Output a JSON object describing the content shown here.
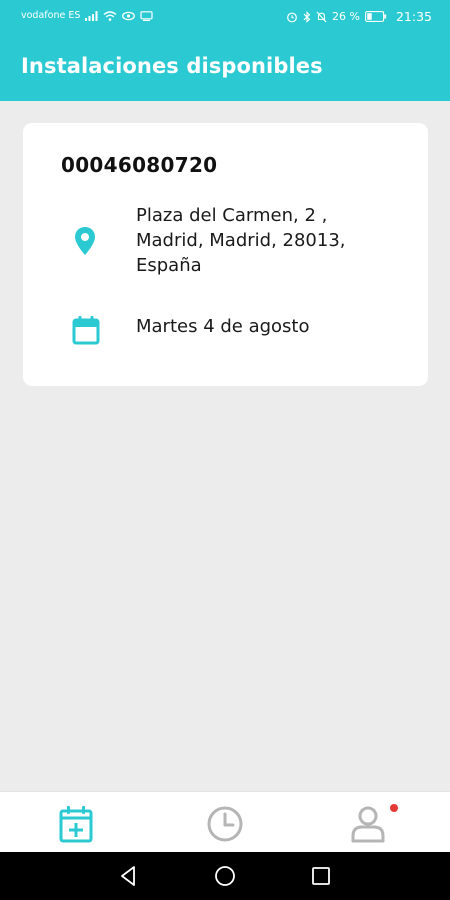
{
  "status_bar": {
    "carrier": "vodafone ES",
    "battery_percent": "26 %",
    "time": "21:35",
    "icons": [
      "signal-icon",
      "wifi-icon",
      "eye-icon",
      "screen-icon",
      "alarm-icon",
      "bluetooth-icon",
      "mute-icon",
      "battery-icon"
    ]
  },
  "header": {
    "title": "Instalaciones disponibles",
    "background_color": "#2bcad3"
  },
  "card": {
    "id_number": "00046080720",
    "address": "Plaza del Carmen, 2 ,\nMadrid, Madrid, 28013,\nEspaña",
    "date": "Martes 4 de agosto",
    "icons": {
      "address": "location-pin-icon",
      "date": "calendar-icon"
    },
    "icon_color": "#2bcad3"
  },
  "bottom_nav": {
    "items": [
      {
        "icon": "calendar-add-icon",
        "active": true
      },
      {
        "icon": "clock-icon",
        "active": false
      },
      {
        "icon": "user-icon",
        "active": false,
        "notification": true
      }
    ],
    "active_color": "#2bcad3",
    "inactive_color": "#b5b5b5",
    "notification_color": "#e53935"
  },
  "system_nav": {
    "icons": [
      "back-icon",
      "home-icon",
      "recents-icon"
    ]
  }
}
